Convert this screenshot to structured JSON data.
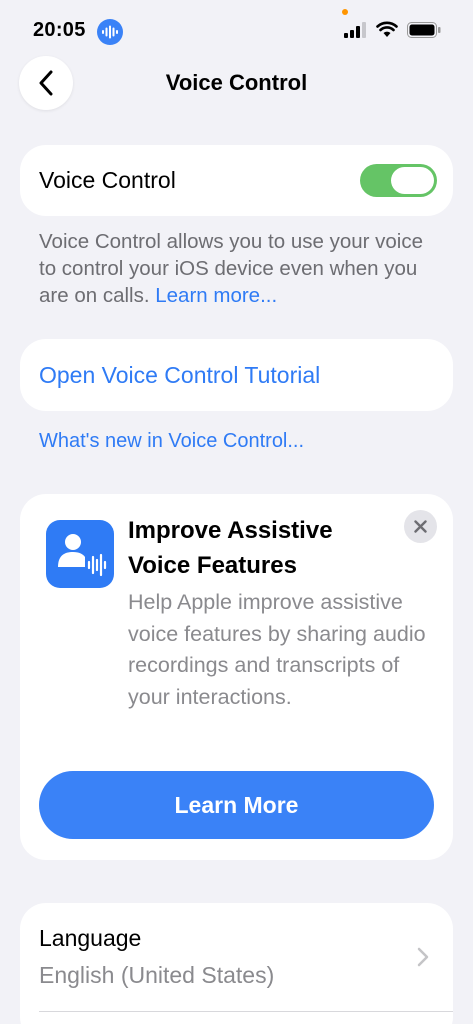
{
  "status_bar": {
    "time": "20:05",
    "icons": [
      "voice-control-active-icon",
      "signal-icon",
      "wifi-icon",
      "battery-icon"
    ]
  },
  "nav": {
    "title": "Voice Control",
    "back_icon": "chevron-left-icon"
  },
  "voice_control_toggle": {
    "label": "Voice Control",
    "on": true
  },
  "description": {
    "text": "Voice Control allows you to use your voice to control your iOS device even when you are on calls. ",
    "link": "Learn more..."
  },
  "tutorial": {
    "label": "Open Voice Control Tutorial"
  },
  "whats_new": {
    "label": "What's new in Voice Control..."
  },
  "promo": {
    "icon": "person-waveform-icon",
    "title": "Improve Assistive Voice Features",
    "body": "Help Apple improve assistive voice features by sharing audio recordings and transcripts of your interactions.",
    "button": "Learn More"
  },
  "language": {
    "label": "Language",
    "value": "English (United States)"
  },
  "colors": {
    "accent": "#2f7bf5",
    "toggle_on": "#65c466",
    "background": "#f2f2f7"
  }
}
